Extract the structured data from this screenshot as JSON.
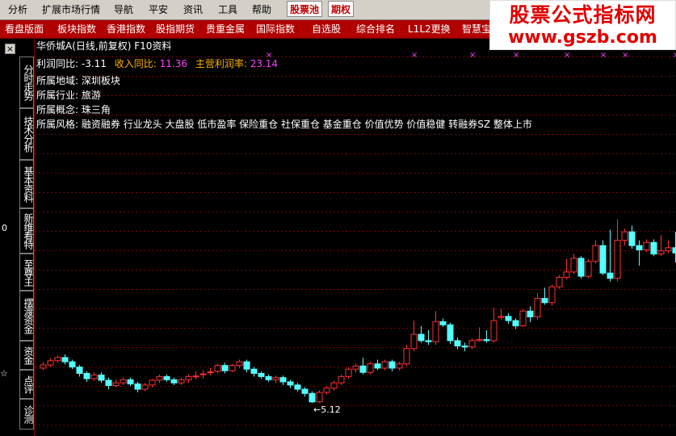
{
  "menubar": {
    "items": [
      "分析",
      "扩展市场行情",
      "导航",
      "平安",
      "资讯",
      "工具",
      "帮助"
    ],
    "highlight_items": [
      "股票池",
      "期权"
    ]
  },
  "tabbar": {
    "items": [
      "看盘版面",
      "板块指数",
      "香港指数",
      "股指期货",
      "贵重金属",
      "国际指数",
      "自选股",
      "综合排名",
      "L1L2更换",
      "智慧宝"
    ]
  },
  "watermark": {
    "title": "股票公式指标网",
    "url": "www.gszb.com"
  },
  "sidetabs": [
    "分时走势",
    "技术分析",
    "基本资料",
    "新维看特",
    "至尊主",
    "摆渡资金",
    "资金",
    "点评",
    "诊测"
  ],
  "left_edge_glyphs": [
    "0",
    "☆"
  ],
  "header": {
    "title": "华侨城A(日线,前复权) F10资料"
  },
  "info": {
    "profit_label": "利润同比:",
    "profit_value": "-3.11",
    "revenue_label": "收入同比:",
    "revenue_value": "11.36",
    "margin_label": "主营利润率:",
    "margin_value": "23.14",
    "region_label": "所属地域:",
    "region_value": "深圳板块",
    "industry_label": "所属行业:",
    "industry_value": "旅游",
    "concept_label": "所属概念:",
    "concept_value": "珠三角",
    "style_label": "所属风格:",
    "style_value": "融资融券 行业龙头 大盘股 低市盈率 保险重仓 社保重仓 基金重仓 价值优势 价值稳健 转融券SZ 整体上市"
  },
  "colors": {
    "up": "#ff3030",
    "down": "#54ffff",
    "grid": "#7a0000",
    "menu_bg": "#d4d0c8",
    "tab_bg": "#b00000",
    "accent": "#e10000"
  },
  "chart_data": {
    "type": "candlestick",
    "low_annotation": "5.12",
    "ylim": [
      4.8,
      9.8
    ],
    "markers_x_index": [
      31,
      51,
      59,
      65,
      72,
      77,
      80,
      87
    ],
    "candles": [
      [
        5.78,
        5.84,
        5.74,
        5.9
      ],
      [
        5.84,
        5.92,
        5.8,
        5.97
      ],
      [
        5.92,
        5.98,
        5.88,
        6.02
      ],
      [
        5.98,
        5.9,
        5.85,
        6.04
      ],
      [
        5.9,
        5.8,
        5.76,
        5.94
      ],
      [
        5.8,
        5.68,
        5.62,
        5.84
      ],
      [
        5.68,
        5.58,
        5.52,
        5.72
      ],
      [
        5.58,
        5.65,
        5.54,
        5.7
      ],
      [
        5.65,
        5.55,
        5.5,
        5.7
      ],
      [
        5.55,
        5.45,
        5.38,
        5.6
      ],
      [
        5.45,
        5.5,
        5.42,
        5.56
      ],
      [
        5.5,
        5.56,
        5.46,
        5.6
      ],
      [
        5.56,
        5.48,
        5.44,
        5.6
      ],
      [
        5.48,
        5.38,
        5.32,
        5.52
      ],
      [
        5.38,
        5.46,
        5.34,
        5.5
      ],
      [
        5.46,
        5.55,
        5.42,
        5.58
      ],
      [
        5.55,
        5.62,
        5.5,
        5.66
      ],
      [
        5.62,
        5.56,
        5.52,
        5.66
      ],
      [
        5.56,
        5.5,
        5.46,
        5.6
      ],
      [
        5.5,
        5.56,
        5.46,
        5.6
      ],
      [
        5.56,
        5.62,
        5.5,
        5.66
      ],
      [
        5.62,
        5.63,
        5.56,
        5.72
      ],
      [
        5.66,
        5.67,
        5.58,
        5.74
      ],
      [
        5.7,
        5.71,
        5.64,
        5.78
      ],
      [
        5.72,
        5.83,
        5.68,
        5.86
      ],
      [
        5.83,
        5.73,
        5.68,
        5.88
      ],
      [
        5.73,
        5.83,
        5.7,
        5.86
      ],
      [
        5.83,
        5.9,
        5.78,
        5.94
      ],
      [
        5.9,
        5.76,
        5.7,
        5.94
      ],
      [
        5.76,
        5.68,
        5.62,
        5.8
      ],
      [
        5.68,
        5.62,
        5.58,
        5.72
      ],
      [
        5.62,
        5.56,
        5.52,
        5.66
      ],
      [
        5.56,
        5.6,
        5.5,
        5.64
      ],
      [
        5.6,
        5.52,
        5.46,
        5.64
      ],
      [
        5.52,
        5.46,
        5.4,
        5.56
      ],
      [
        5.46,
        5.38,
        5.34,
        5.5
      ],
      [
        5.38,
        5.3,
        5.24,
        5.42
      ],
      [
        5.3,
        5.14,
        5.12,
        5.34
      ],
      [
        5.14,
        5.32,
        5.12,
        5.36
      ],
      [
        5.32,
        5.4,
        5.28,
        5.44
      ],
      [
        5.4,
        5.5,
        5.36,
        5.54
      ],
      [
        5.5,
        5.62,
        5.46,
        5.66
      ],
      [
        5.62,
        5.76,
        5.58,
        5.8
      ],
      [
        5.76,
        5.82,
        5.7,
        5.86
      ],
      [
        5.82,
        5.7,
        5.66,
        5.98
      ],
      [
        5.7,
        5.86,
        5.66,
        5.9
      ],
      [
        5.86,
        5.78,
        5.74,
        5.94
      ],
      [
        5.78,
        5.9,
        5.74,
        5.94
      ],
      [
        5.9,
        5.78,
        5.72,
        5.94
      ],
      [
        5.78,
        5.86,
        5.74,
        5.9
      ],
      [
        5.86,
        6.15,
        5.82,
        6.22
      ],
      [
        6.15,
        6.42,
        6.1,
        6.68
      ],
      [
        6.42,
        6.3,
        6.26,
        6.58
      ],
      [
        6.3,
        6.28,
        6.22,
        6.5
      ],
      [
        6.28,
        6.66,
        6.22,
        6.86
      ],
      [
        6.66,
        6.6,
        6.56,
        6.72
      ],
      [
        6.6,
        6.3,
        6.24,
        6.64
      ],
      [
        6.3,
        6.2,
        6.14,
        6.36
      ],
      [
        6.2,
        6.18,
        6.1,
        6.26
      ],
      [
        6.18,
        6.3,
        6.14,
        6.34
      ],
      [
        6.3,
        6.32,
        6.28,
        6.55
      ],
      [
        6.32,
        6.3,
        6.26,
        6.5
      ],
      [
        6.3,
        6.68,
        6.26,
        6.92
      ],
      [
        6.74,
        6.76,
        6.7,
        6.9
      ],
      [
        6.76,
        6.68,
        6.62,
        6.82
      ],
      [
        6.68,
        6.58,
        6.52,
        6.72
      ],
      [
        6.58,
        6.86,
        6.56,
        6.9
      ],
      [
        6.86,
        6.75,
        6.65,
        6.95
      ],
      [
        6.75,
        7.1,
        6.7,
        7.2
      ],
      [
        7.1,
        7.02,
        6.98,
        7.3
      ],
      [
        7.02,
        7.32,
        6.96,
        7.36
      ],
      [
        7.32,
        7.5,
        7.28,
        7.54
      ],
      [
        7.5,
        7.6,
        7.46,
        7.85
      ],
      [
        7.6,
        7.86,
        7.56,
        7.95
      ],
      [
        7.86,
        7.52,
        7.48,
        7.9
      ],
      [
        7.52,
        7.8,
        7.48,
        7.84
      ],
      [
        7.8,
        8.1,
        7.76,
        8.2
      ],
      [
        8.1,
        7.58,
        7.54,
        8.2
      ],
      [
        7.58,
        7.48,
        7.42,
        8.4
      ],
      [
        7.48,
        8.2,
        7.42,
        8.6
      ],
      [
        8.2,
        8.36,
        8.1,
        8.42
      ],
      [
        8.36,
        8.1,
        8.04,
        8.48
      ],
      [
        8.1,
        8.02,
        7.72,
        8.2
      ],
      [
        8.02,
        8.16,
        7.98,
        8.22
      ],
      [
        8.16,
        7.94,
        7.9,
        8.22
      ],
      [
        7.94,
        8.0,
        7.9,
        8.3
      ],
      [
        8.0,
        8.06,
        7.96,
        8.2
      ],
      [
        8.06,
        7.96,
        7.78,
        8.36
      ]
    ]
  }
}
